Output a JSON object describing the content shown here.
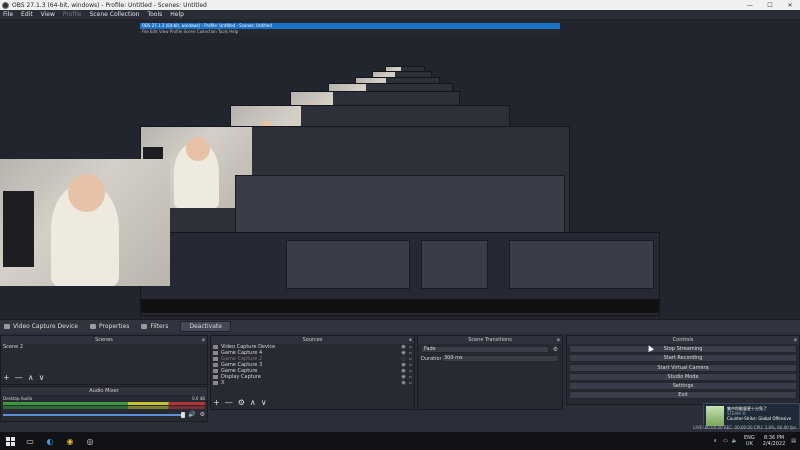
{
  "window": {
    "title": "OBS 27.1.3 (64-bit, windows) - Profile: Untitled - Scenes: Untitled",
    "minimize": "—",
    "maximize": "☐",
    "close": "✕"
  },
  "menu": [
    "File",
    "Edit",
    "View",
    "Profile",
    "Scene Collection",
    "Tools",
    "Help"
  ],
  "preview": {
    "inner_title": "OBS 27.1.3 (64-bit, windows) - Profile: Untitled - Scenes: Untitled",
    "inner_menu": "File  Edit  View  Profile  Scene Collection  Tools  Help"
  },
  "context_bar": {
    "source": "Video Capture Device",
    "properties": "Properties",
    "filters": "Filters",
    "deactivate": "Deactivate"
  },
  "scenes": {
    "title": "Scenes",
    "items": [
      "Scene 2"
    ],
    "toolbar": [
      "+",
      "—",
      "∧",
      "∨"
    ]
  },
  "audio_mixer": {
    "title": "Audio Mixer",
    "channel": "Desktop Audio",
    "level": "0.0 dB"
  },
  "sources": {
    "title": "Sources",
    "items": [
      {
        "label": "Video Capture Device",
        "dim": false
      },
      {
        "label": "Game Capture 4",
        "dim": false
      },
      {
        "label": "Game Capture 2",
        "dim": true
      },
      {
        "label": "Game Capture 3",
        "dim": false
      },
      {
        "label": "Game Capture",
        "dim": false
      },
      {
        "label": "Display Capture",
        "dim": false
      },
      {
        "label": "X",
        "dim": false
      }
    ],
    "toolbar": [
      "+",
      "—",
      "⚙",
      "∧",
      "∨"
    ]
  },
  "transitions": {
    "title": "Scene Transitions",
    "type": "Fade",
    "duration_label": "Duration",
    "duration_value": "300 ms"
  },
  "controls": {
    "title": "Controls",
    "buttons": [
      "Stop Streaming",
      "Start Recording",
      "Start Virtual Camera",
      "Studio Mode",
      "Settings",
      "Exit"
    ]
  },
  "notification": {
    "line1": "集中你能量更十分兔了",
    "line2": "Counter-Strike: Global Offensive",
    "app": "STEAM ®"
  },
  "status": {
    "text": "LIVE: 00:00:00   REC: 00:00:00   CPU: 3.8%, 60.00 fps"
  },
  "taskbar": {
    "lang1": "ENG",
    "lang2": "UK",
    "time": "8:36 PM",
    "date": "2/4/2022"
  }
}
